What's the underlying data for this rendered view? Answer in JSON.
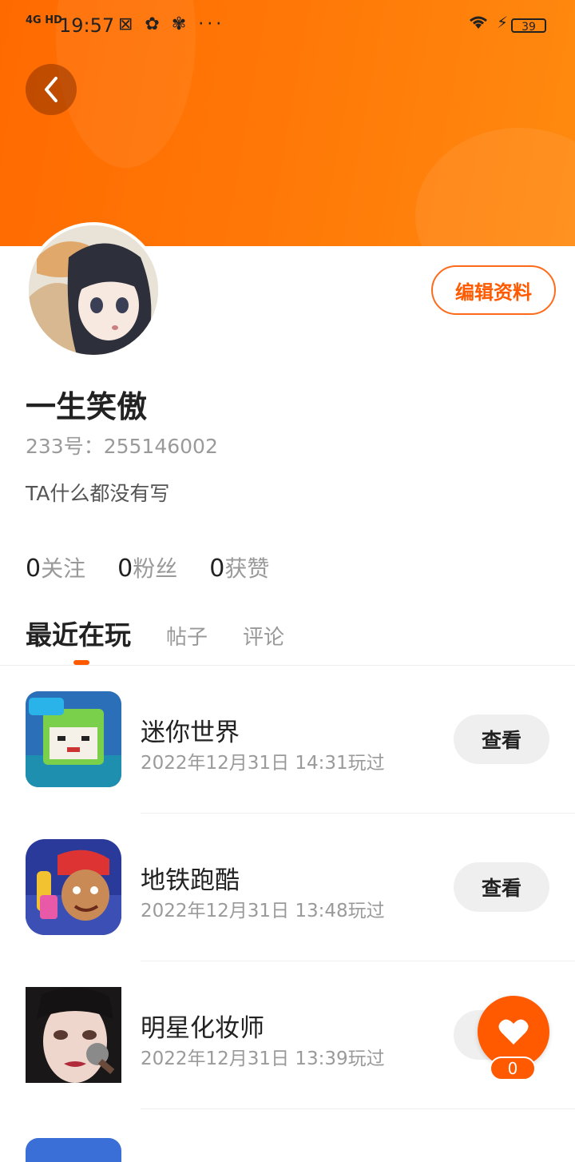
{
  "status_bar": {
    "network": "4G HD",
    "time": "19:57",
    "extra_icons": "⊠ ✿ ✾ ···",
    "battery": "39"
  },
  "profile": {
    "username": "一生笑傲",
    "id_label": "233号：255146002",
    "bio": "TA什么都没有写",
    "edit_button": "编辑资料"
  },
  "stats": [
    {
      "count": "0",
      "label": "关注"
    },
    {
      "count": "0",
      "label": "粉丝"
    },
    {
      "count": "0",
      "label": "获赞"
    }
  ],
  "tabs": [
    {
      "label": "最近在玩",
      "active": true
    },
    {
      "label": "帖子",
      "active": false
    },
    {
      "label": "评论",
      "active": false
    }
  ],
  "games": [
    {
      "name": "迷你世界",
      "time": "2022年12月31日 14:31玩过",
      "button": "查看",
      "icon": "mini-world-icon"
    },
    {
      "name": "地铁跑酷",
      "time": "2022年12月31日 13:48玩过",
      "button": "查看",
      "icon": "subway-surfers-icon"
    },
    {
      "name": "明星化妆师",
      "time": "2022年12月31日 13:39玩过",
      "button": "查看",
      "icon": "makeup-artist-icon"
    }
  ],
  "fab": {
    "count": "0"
  },
  "colors": {
    "accent": "#ff5a00",
    "header": "#ff7000"
  }
}
